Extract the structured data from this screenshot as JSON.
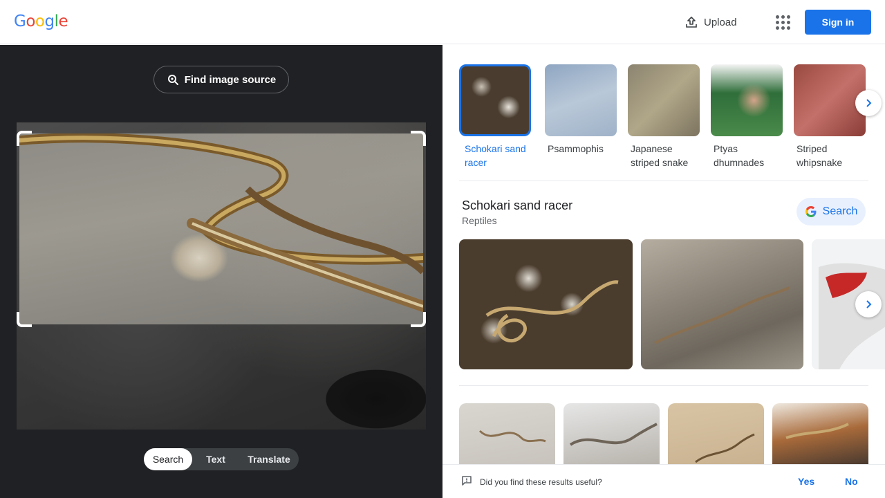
{
  "header": {
    "logo": [
      "G",
      "o",
      "o",
      "g",
      "l",
      "e"
    ],
    "upload_label": "Upload",
    "signin_label": "Sign in"
  },
  "left": {
    "find_source_label": "Find image source",
    "modes": [
      {
        "label": "Search",
        "active": true
      },
      {
        "label": "Text",
        "active": false
      },
      {
        "label": "Translate",
        "active": false
      }
    ]
  },
  "entities": [
    {
      "label": "Schokari sand racer",
      "active": true
    },
    {
      "label": "Psammophis",
      "active": false
    },
    {
      "label": "Japanese striped snake",
      "active": false
    },
    {
      "label": "Ptyas dhumnades",
      "active": false
    },
    {
      "label": "Striped whipsnake",
      "active": false
    }
  ],
  "knowledge": {
    "title": "Schokari sand racer",
    "subtitle": "Reptiles",
    "search_label": "Search"
  },
  "feedback": {
    "question": "Did you find these results useful?",
    "yes": "Yes",
    "no": "No"
  },
  "colors": {
    "accent": "#1a73e8",
    "left_bg": "#202124"
  }
}
